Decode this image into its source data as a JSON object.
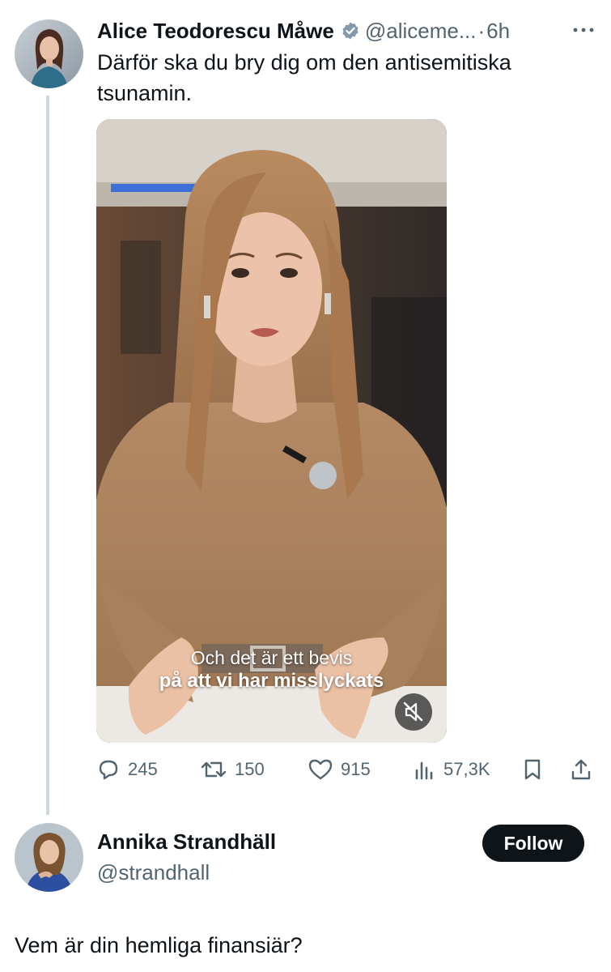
{
  "tweet": {
    "author_name": "Alice Teodorescu Måwe",
    "author_handle": "@aliceme...",
    "separator": "·",
    "time": "6h",
    "text": "Därför ska du bry dig om den antisemitiska tsunamin.",
    "video": {
      "caption_line1": "Och det är ett bevis",
      "caption_line2": "på att vi har misslyckats"
    },
    "stats": {
      "replies": "245",
      "retweets": "150",
      "likes": "915",
      "views": "57,3K"
    }
  },
  "reply_user": {
    "name": "Annika Strandhäll",
    "handle": "@strandhall",
    "follow_label": "Follow"
  },
  "reply_text": "Vem är din hemliga finansiär?",
  "colors": {
    "text_primary": "#0f1419",
    "text_secondary": "#536471",
    "thread_line": "#cfd9de",
    "verified_badge": "#829aab",
    "follow_bg": "#0f1419"
  },
  "icons": [
    "more-icon",
    "verified-badge-icon",
    "reply-icon",
    "retweet-icon",
    "like-icon",
    "views-icon",
    "bookmark-icon",
    "share-icon",
    "mute-icon"
  ]
}
